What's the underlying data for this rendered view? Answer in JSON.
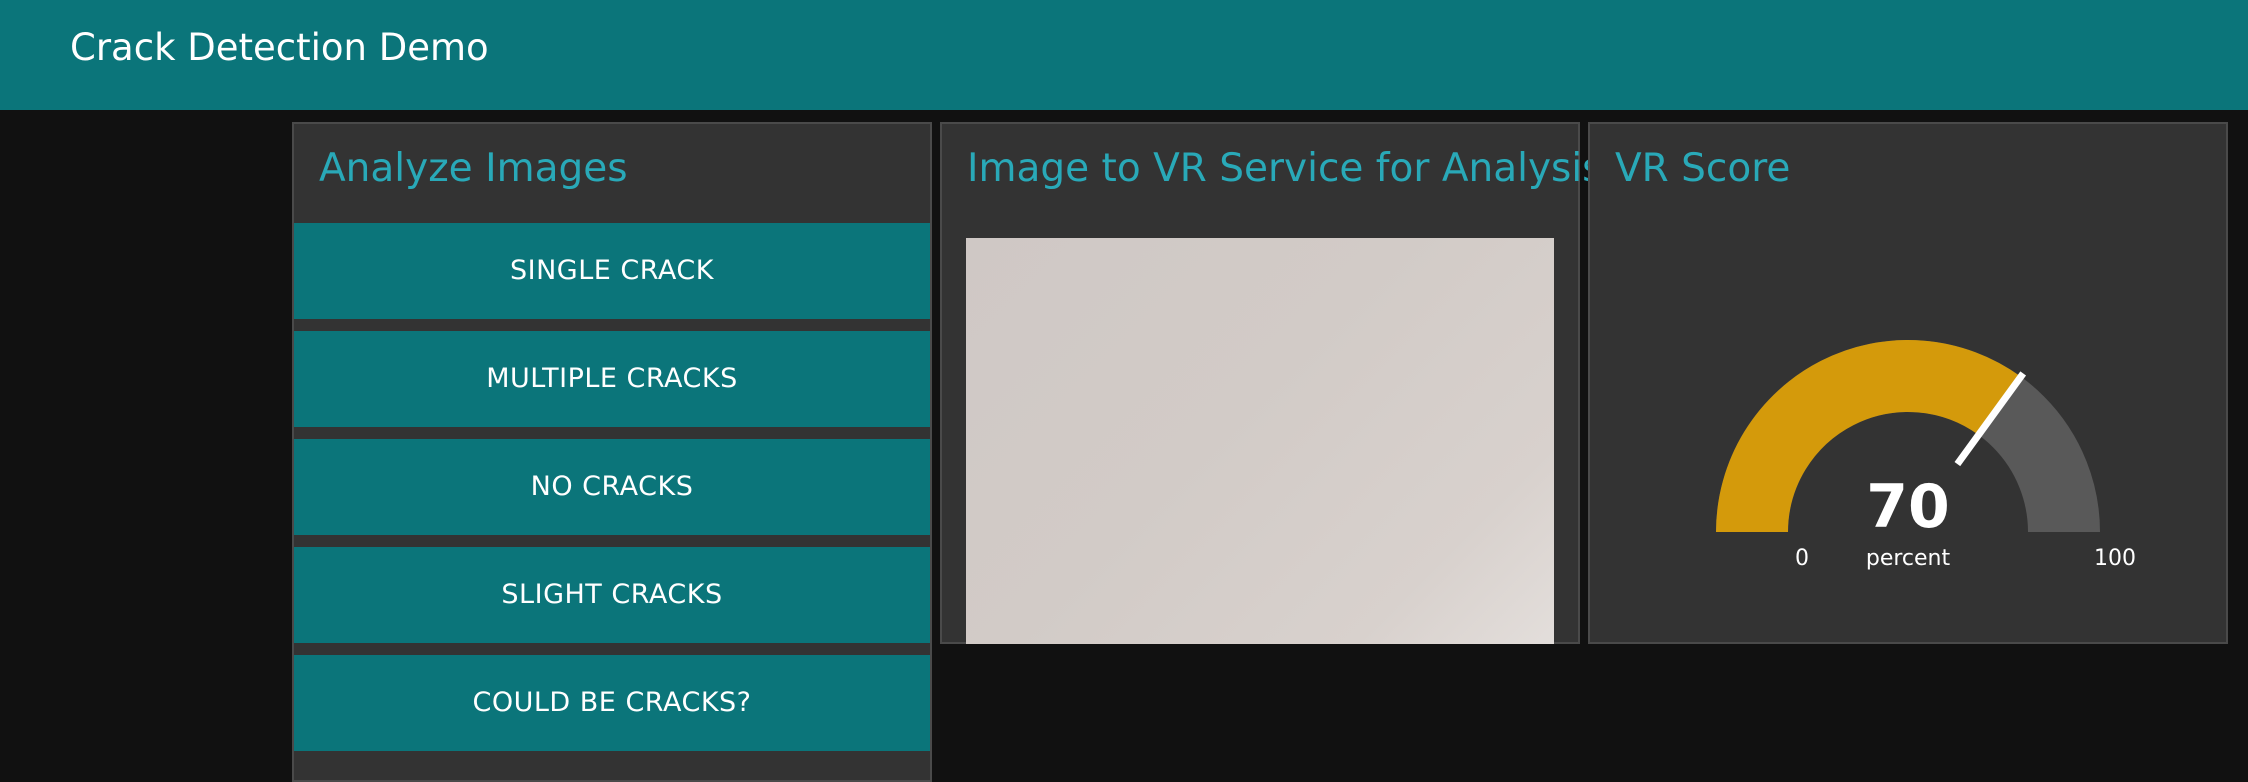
{
  "header": {
    "title": "Crack Detection Demo"
  },
  "analyze_panel": {
    "title": "Analyze Images",
    "buttons": [
      {
        "label": "SINGLE CRACK"
      },
      {
        "label": "MULTIPLE CRACKS"
      },
      {
        "label": "NO CRACKS"
      },
      {
        "label": "SLIGHT CRACKS"
      },
      {
        "label": "COULD BE CRACKS?"
      }
    ]
  },
  "image_panel": {
    "title": "Image to VR Service for Analysis"
  },
  "score_panel": {
    "title": "VR Score",
    "gauge": {
      "value": "70",
      "units": "percent",
      "min": "0",
      "max": "100",
      "fill_color": "#d49a0b",
      "track_color": "#595959",
      "needle_color": "#ffffff"
    }
  },
  "colors": {
    "accent": "#0b757a",
    "title_text": "#29a9b8",
    "panel_bg": "#333333",
    "page_bg": "#111111"
  }
}
